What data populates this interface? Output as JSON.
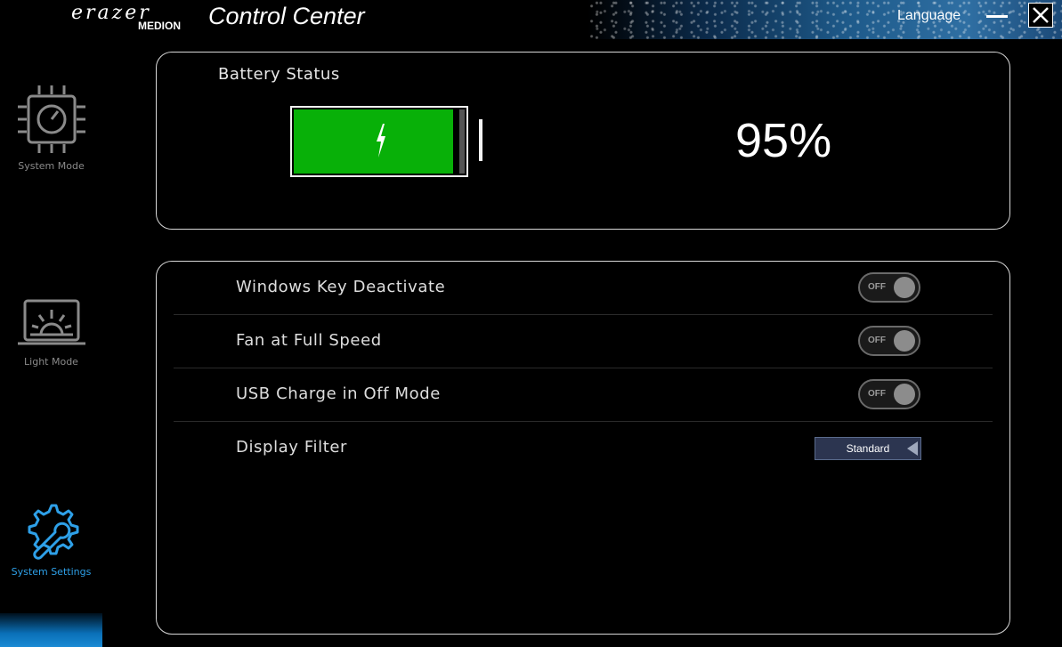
{
  "app": {
    "brand_top": "erazer",
    "brand_bottom": "MEDION",
    "title": "Control Center",
    "language_label": "Language",
    "minimize_icon": "minimize-icon",
    "close_icon": "close-icon"
  },
  "sidebar": {
    "items": [
      {
        "label": "System Mode",
        "icon": "cpu-gauge-icon",
        "active": false
      },
      {
        "label": "Light Mode",
        "icon": "laptop-sunrise-icon",
        "active": false
      },
      {
        "label": "System Settings",
        "icon": "gear-wrench-icon",
        "active": true
      }
    ]
  },
  "battery": {
    "title": "Battery Status",
    "percent_text": "95%",
    "level": 0.95,
    "charging_icon": "lightning-bolt-icon",
    "fill_color": "#08b008"
  },
  "settings": {
    "rows": [
      {
        "label": "Windows Key Deactivate",
        "control": "toggle",
        "state": "OFF"
      },
      {
        "label": "Fan at Full Speed",
        "control": "toggle",
        "state": "OFF"
      },
      {
        "label": "USB Charge in Off Mode",
        "control": "toggle",
        "state": "OFF"
      },
      {
        "label": "Display Filter",
        "control": "dropdown",
        "value": "Standard"
      }
    ]
  },
  "colors": {
    "accent": "#2ea0e8",
    "inactive_text": "#8a8a8a",
    "panel_border": "#d8d8d8"
  }
}
